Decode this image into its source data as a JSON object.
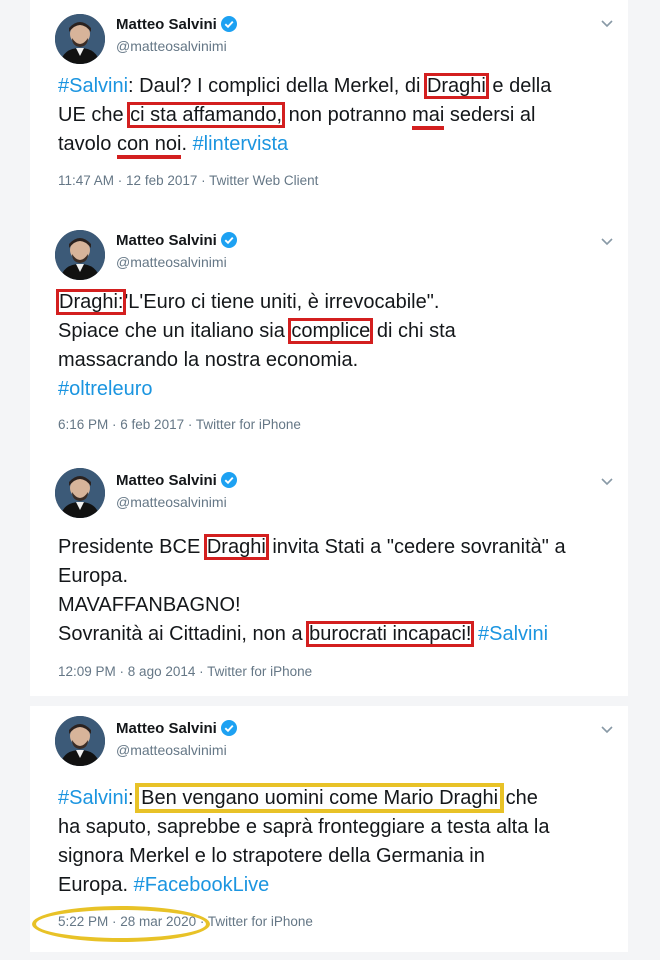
{
  "tweets": [
    {
      "name": "Matteo Salvini",
      "handle": "@matteosalvinimi",
      "lines": [
        [
          "#Salvini",
          ": Daul? I complici della Merkel, di ",
          "Draghi",
          " e della"
        ],
        [
          "UE che ",
          "ci sta affamando,",
          " non potranno ",
          "mai",
          " sedersi al"
        ],
        [
          "tavolo ",
          "con noi",
          ". ",
          "#lintervista"
        ]
      ],
      "time": "11:47 AM",
      "date": "12 feb 2017",
      "source": "Twitter Web Client"
    },
    {
      "name": "Matteo Salvini",
      "handle": "@matteosalvinimi",
      "lines": [
        [
          "Draghi:",
          "'L'Euro ci tiene uniti, è irrevocabile\"."
        ],
        [
          "Spiace che un italiano sia ",
          "complice",
          " di chi sta"
        ],
        [
          "massacrando la nostra economia."
        ],
        [
          "#oltreleuro"
        ]
      ],
      "time": "6:16 PM",
      "date": "6 feb 2017",
      "source": "Twitter for iPhone"
    },
    {
      "name": "Matteo Salvini",
      "handle": "@matteosalvinimi",
      "lines": [
        [
          "Presidente BCE ",
          "Draghi",
          " invita Stati a \"cedere sovranità\" a"
        ],
        [
          "Europa."
        ],
        [
          "MAVAFFANBAGNO!"
        ],
        [
          "Sovranità ai Cittadini, non a ",
          "burocrati incapaci!",
          " ",
          "#Salvini"
        ]
      ],
      "time": "12:09 PM",
      "date": "8 ago 2014",
      "source": "Twitter for iPhone"
    },
    {
      "name": "Matteo Salvini",
      "handle": "@matteosalvinimi",
      "lines": [
        [
          "#Salvini",
          ": ",
          "Ben vengano uomini come Mario Draghi",
          " che"
        ],
        [
          "ha saputo, saprebbe e saprà fronteggiare a testa alta la"
        ],
        [
          "signora Merkel e lo strapotere della Germania in"
        ],
        [
          "Europa. ",
          "#FacebookLive"
        ]
      ],
      "time": "5:22 PM",
      "date": "28 mar 2020",
      "source": "Twitter for iPhone"
    }
  ],
  "colors": {
    "hashtag": "#1b95e0",
    "red_annotation": "#d31f1f",
    "yellow_annotation": "#e8c227",
    "verified": "#1da1f2"
  },
  "icons": [
    "verified-badge-icon",
    "chevron-down-icon",
    "avatar"
  ]
}
